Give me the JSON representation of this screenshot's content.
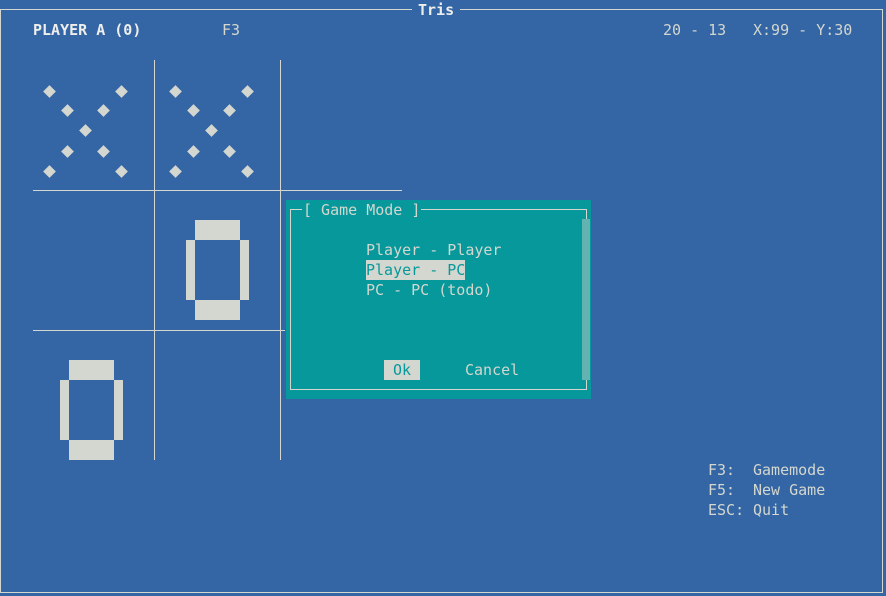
{
  "window": {
    "title": "Tris"
  },
  "header": {
    "player": "PLAYER A (0)",
    "hint_key": "F3",
    "score": "20 - 13",
    "cursor": "X:99 - Y:30"
  },
  "board": {
    "cells": [
      "X",
      "X",
      "",
      "",
      "O",
      "",
      "O",
      "",
      ""
    ]
  },
  "dialog": {
    "title": "[ Game Mode ]",
    "options": [
      "Player - Player",
      "Player - PC",
      "PC - PC (todo)"
    ],
    "selected_index": 1,
    "ok_label": "Ok",
    "cancel_label": "Cancel"
  },
  "help": {
    "lines": [
      {
        "key": "F3:",
        "action": "Gamemode"
      },
      {
        "key": "F5:",
        "action": "New Game"
      },
      {
        "key": "ESC:",
        "action": "Quit"
      }
    ]
  },
  "colors": {
    "background": "#3465a4",
    "dialog": "#06989a",
    "foreground": "#d3d7cf"
  }
}
